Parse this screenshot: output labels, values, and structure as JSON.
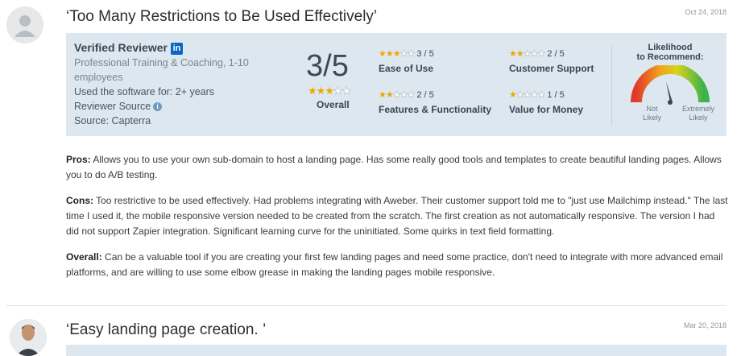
{
  "review1": {
    "title": "‘Too Many Restrictions to Be Used Effectively’",
    "date": "Oct 24, 2018",
    "reviewer": {
      "name": "Verified Reviewer",
      "linkedin_icon_text": "in",
      "company": "Professional Training & Coaching, 1-10",
      "company_size": "employees",
      "usage": "Used the software for: 2+ years",
      "reviewer_source_label": "Reviewer Source",
      "source": "Source: Capterra"
    },
    "overall": {
      "score": "3/5",
      "value": 3,
      "max": 5,
      "label": "Overall"
    },
    "sub_ratings": [
      {
        "label": "Ease of Use",
        "value": 3,
        "text": "3 / 5"
      },
      {
        "label": "Customer Support",
        "value": 2,
        "text": "2 / 5"
      },
      {
        "label": "Features & Functionality",
        "value": 2,
        "text": "2 / 5"
      },
      {
        "label": "Value for Money",
        "value": 1,
        "text": "1 / 5"
      }
    ],
    "recommend": {
      "title_line1": "Likelihood",
      "title_line2": "to Recommend:",
      "low_line1": "Not",
      "low_line2": "Likely",
      "high_line1": "Extremely",
      "high_line2": "Likely"
    },
    "pros_label": "Pros:",
    "pros_text": "Allows you to use your own sub-domain to host a landing page. Has some really good tools and templates to create beautiful landing pages. Allows you to do A/B testing.",
    "cons_label": "Cons:",
    "cons_text": "Too restrictive to be used effectively. Had problems integrating with Aweber. Their customer support told me to \"just use Mailchimp instead.\" The last time I used it, the mobile responsive version needed to be created from the scratch. The first creation as not automatically responsive. The version I had did not support Zapier integration. Significant learning curve for the uninitiated. Some quirks in text field formatting.",
    "overall_label": "Overall:",
    "overall_text": "Can be a valuable tool if you are creating your first few landing pages and need some practice, don't need to integrate with more advanced email platforms, and are willing to use some elbow grease in making the landing pages mobile responsive."
  },
  "review2": {
    "title": "‘Easy landing page creation. ’",
    "date": "Mar 20, 2018"
  },
  "colors": {
    "star": "#f0a500",
    "panel": "#dde7ef",
    "linkedin": "#0a66c2"
  }
}
